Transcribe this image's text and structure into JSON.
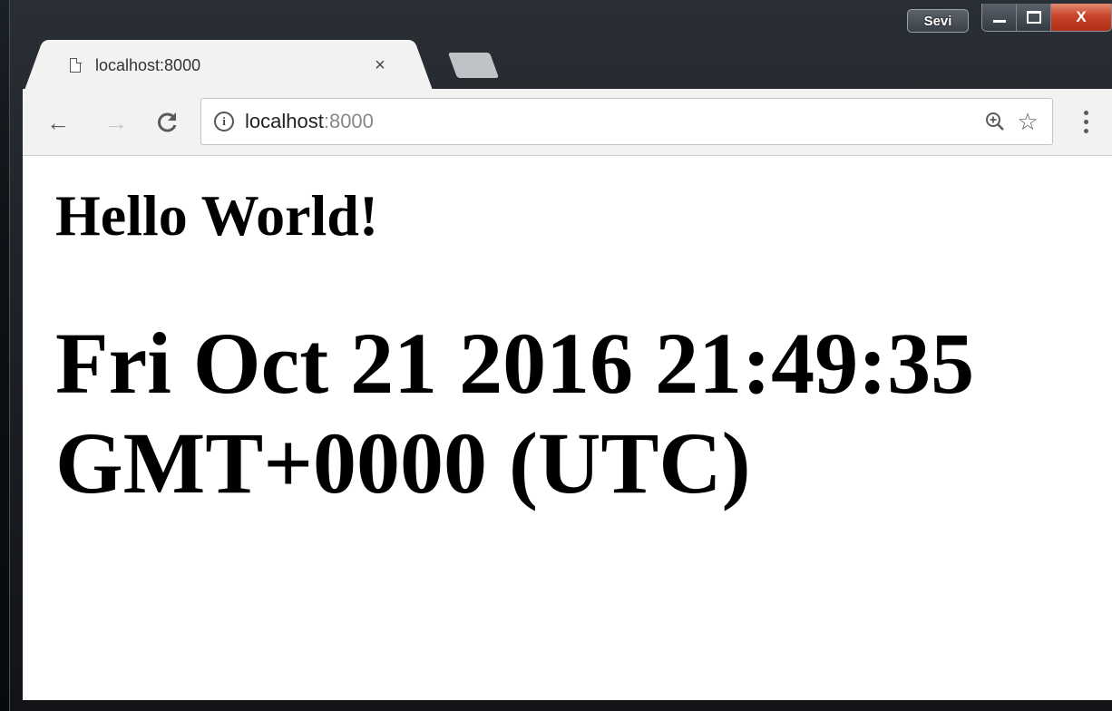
{
  "window": {
    "profile_name": "Sevi",
    "close_glyph": "X"
  },
  "tab": {
    "title": "localhost:8000",
    "close_glyph": "×"
  },
  "omnibox": {
    "url_host": "localhost",
    "url_port": ":8000"
  },
  "page": {
    "heading": "Hello World!",
    "datetime": "Fri Oct 21 2016 21:49:35 GMT+0000 (UTC)"
  },
  "icons": {
    "back": "←",
    "forward": "→",
    "reload": "C",
    "star": "☆",
    "info": "i"
  }
}
